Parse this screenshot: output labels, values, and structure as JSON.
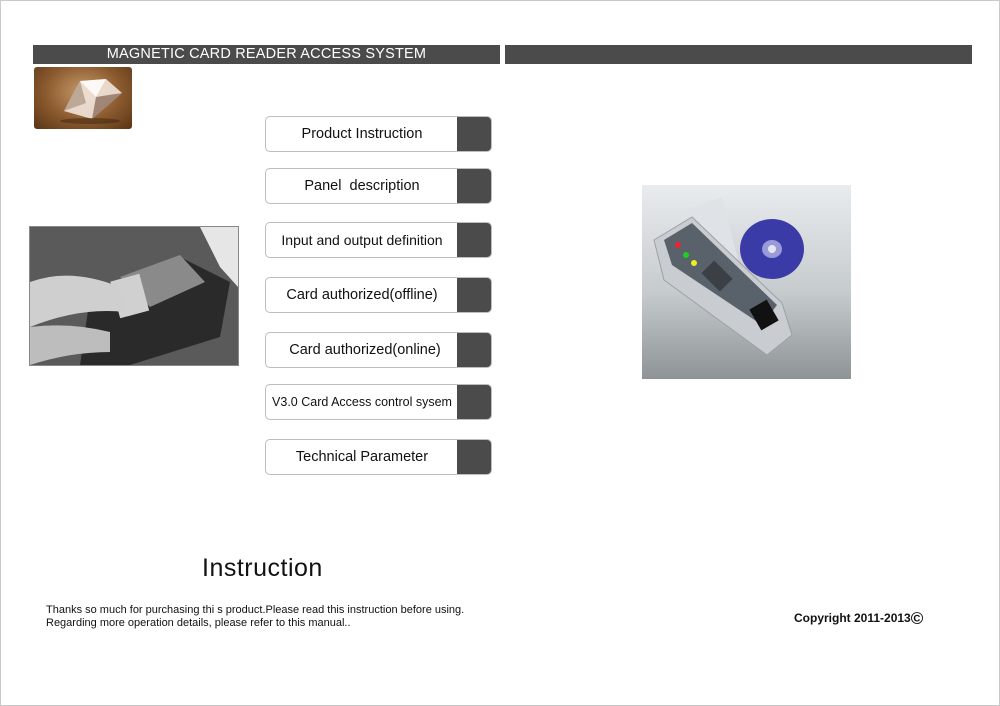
{
  "header": {
    "title": "MAGNETIC CARD READER ACCESS SYSTEM"
  },
  "images": {
    "diamond": "diamond-photo",
    "card_swipe": "card-swipe-terminal-photo",
    "product": "magnetic-card-reader-with-driver-cd-photo"
  },
  "menu": {
    "items": [
      {
        "label": "Product Instruction"
      },
      {
        "label": "Panel  description"
      },
      {
        "label": "Input and output definition"
      },
      {
        "label": "Card authorized(offline)"
      },
      {
        "label": "Card authorized(online)"
      },
      {
        "label": "V3.0 Card Access control sysem"
      },
      {
        "label": "Technical Parameter"
      }
    ]
  },
  "main": {
    "title": "Instruction",
    "intro_line1": "Thanks so much for purchasing thi s product.Please read this instruction before using.",
    "intro_line2": "Regarding more operation details, please refer to this manual.."
  },
  "footer": {
    "copyright": "Copyright 2011-2013",
    "copyright_symbol": "©"
  },
  "colors": {
    "bar": "#4b4b4b",
    "border": "#bdbdbd"
  }
}
